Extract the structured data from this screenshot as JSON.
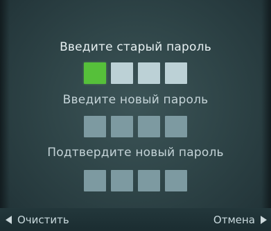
{
  "old_password": {
    "label": "Введите старый пароль",
    "digits": [
      "active",
      "empty",
      "empty",
      "empty"
    ]
  },
  "new_password": {
    "label": "Введите новый пароль",
    "digits": [
      "empty",
      "empty",
      "empty",
      "empty"
    ]
  },
  "confirm_password": {
    "label": "Подтвердите новый пароль",
    "digits": [
      "empty",
      "empty",
      "empty",
      "empty"
    ]
  },
  "footer": {
    "clear_label": "Очистить",
    "clear_icon": "left-triangle-icon",
    "cancel_label": "Отмена",
    "cancel_icon": "right-triangle-icon"
  },
  "colors": {
    "active_digit": "#56c03a",
    "background": "#2f4548"
  }
}
